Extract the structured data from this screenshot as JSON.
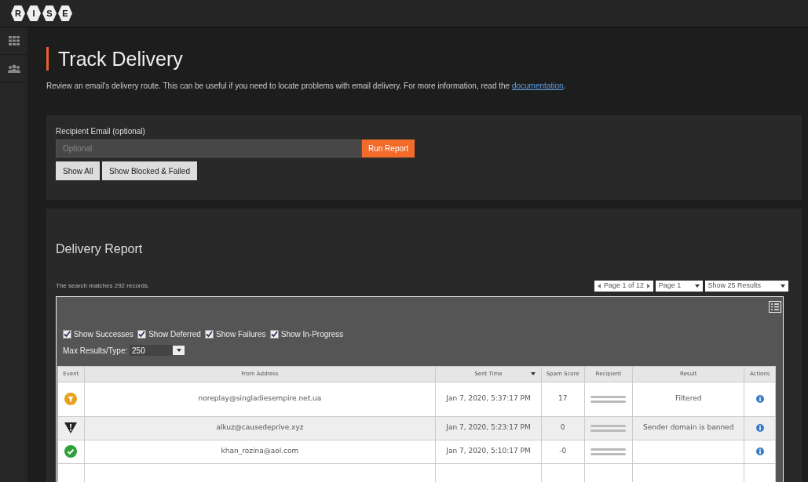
{
  "logo_letters": [
    "R",
    "I",
    "S",
    "E"
  ],
  "sidebar": {
    "items": [
      {
        "kind": "grid",
        "selected": false
      },
      {
        "kind": "people",
        "selected": false
      }
    ]
  },
  "page": {
    "title": "Track Delivery",
    "description": "Review an email's delivery route. This can be useful if you need to locate problems with email delivery. For more information, read the ",
    "link": "documentation",
    "description_end": "."
  },
  "filter": {
    "label": "Recipient Email (optional)",
    "placeholder": "Optional",
    "run_button": "Run Report",
    "buttons": [
      "Show All",
      "Show Blocked & Failed"
    ]
  },
  "report": {
    "title": "Delivery Report",
    "summary": "The search matches 292 records.",
    "pager": {
      "text": "Page 1 of 12",
      "page_select": "Page 1",
      "size_select": "Show 25 Results"
    },
    "toggles": [
      {
        "label": "Show Successes",
        "checked": true
      },
      {
        "label": "Show Deferred",
        "checked": true
      },
      {
        "label": "Show Failures",
        "checked": true
      },
      {
        "label": "Show In-Progress",
        "checked": true
      }
    ],
    "max_results": {
      "label": "Max Results/Type:",
      "value": "250"
    },
    "table": {
      "columns": [
        "Event",
        "From Address",
        "Sent Time",
        "Spam Score",
        "Recipient",
        "Result",
        "Actions"
      ],
      "rows": [
        {
          "kind": "filtered",
          "from": "noreplay@singladiesempire.net.ua",
          "sent": "Jan 7, 2020, 5:37:17 PM",
          "spam": "17",
          "result": "Filtered"
        },
        {
          "kind": "blocked",
          "from": "alkuz@causedeprive.xyz",
          "sent": "Jan 7, 2020, 5:23:17 PM",
          "spam": "0",
          "result": "Sender domain is banned"
        },
        {
          "kind": "success",
          "from": "khan_rozina@aol.com",
          "sent": "Jan 7, 2020, 5:10:17 PM",
          "spam": "-0"
        }
      ]
    }
  }
}
